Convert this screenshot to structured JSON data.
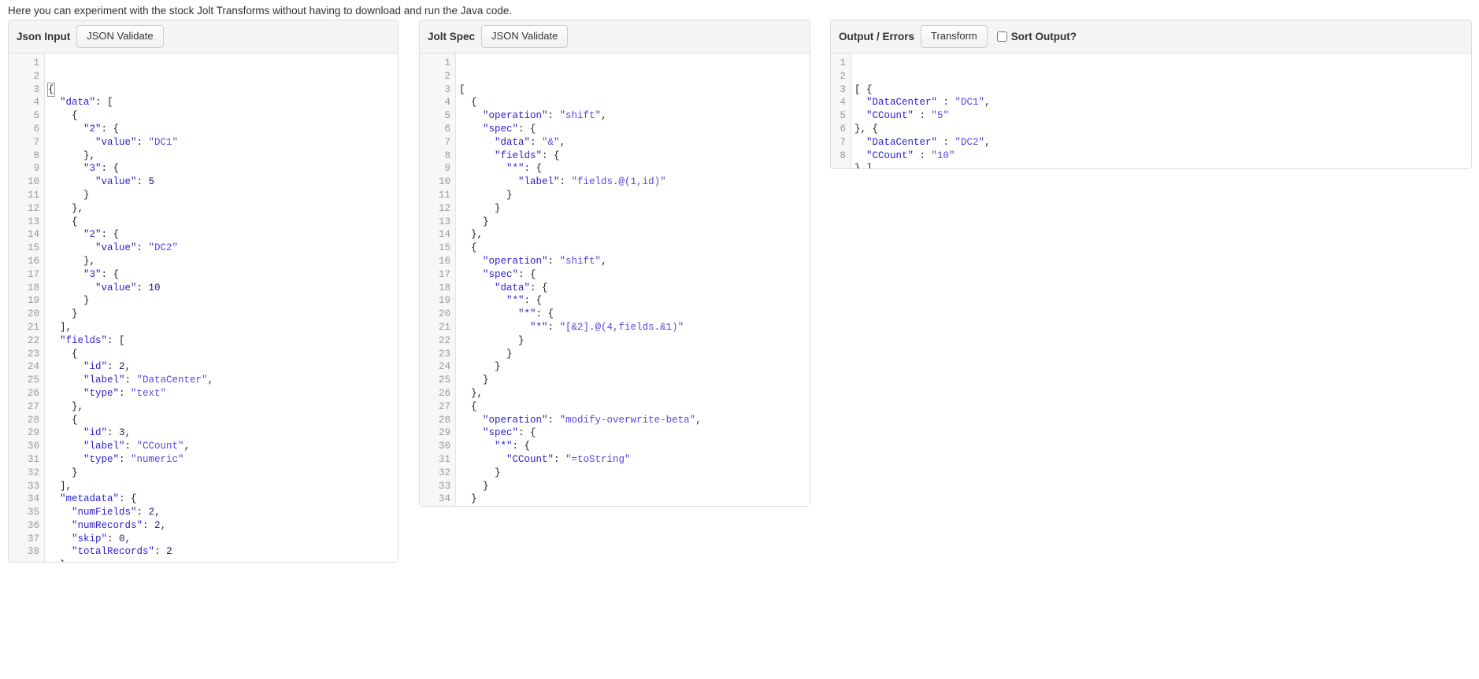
{
  "intro": {
    "text": "Here you can experiment with the stock Jolt Transforms without having to download and run the Java code."
  },
  "panels": {
    "input": {
      "title": "Json Input",
      "validate_button": "JSON Validate",
      "line_count": 38,
      "lines": [
        "{",
        "  \"data\": [",
        "    {",
        "      \"2\": {",
        "        \"value\": \"DC1\"",
        "      },",
        "      \"3\": {",
        "        \"value\": 5",
        "      }",
        "    },",
        "    {",
        "      \"2\": {",
        "        \"value\": \"DC2\"",
        "      },",
        "      \"3\": {",
        "        \"value\": 10",
        "      }",
        "    }",
        "  ],",
        "  \"fields\": [",
        "    {",
        "      \"id\": 2,",
        "      \"label\": \"DataCenter\",",
        "      \"type\": \"text\"",
        "    },",
        "    {",
        "      \"id\": 3,",
        "      \"label\": \"CCount\",",
        "      \"type\": \"numeric\"",
        "    }",
        "  ],",
        "  \"metadata\": {",
        "    \"numFields\": 2,",
        "    \"numRecords\": 2,",
        "    \"skip\": 0,",
        "    \"totalRecords\": 2",
        "  }",
        "}"
      ]
    },
    "spec": {
      "title": "Jolt Spec",
      "validate_button": "JSON Validate",
      "line_count": 34,
      "lines": [
        "[",
        "  {",
        "    \"operation\": \"shift\",",
        "    \"spec\": {",
        "      \"data\": \"&\",",
        "      \"fields\": {",
        "        \"*\": {",
        "          \"label\": \"fields.@(1,id)\"",
        "        }",
        "      }",
        "    }",
        "  },",
        "  {",
        "    \"operation\": \"shift\",",
        "    \"spec\": {",
        "      \"data\": {",
        "        \"*\": {",
        "          \"*\": {",
        "            \"*\": \"[&2].@(4,fields.&1)\"",
        "          }",
        "        }",
        "      }",
        "    }",
        "  },",
        "  {",
        "    \"operation\": \"modify-overwrite-beta\",",
        "    \"spec\": {",
        "      \"*\": {",
        "        \"CCount\": \"=toString\"",
        "      }",
        "    }",
        "  }",
        "]",
        ""
      ]
    },
    "output": {
      "title": "Output / Errors",
      "transform_button": "Transform",
      "sort_checkbox_label": "Sort Output?",
      "sort_checked": false,
      "line_count": 8,
      "lines": [
        "[ {",
        "  \"DataCenter\" : \"DC1\",",
        "  \"CCount\" : \"5\"",
        "}, {",
        "  \"DataCenter\" : \"DC2\",",
        "  \"CCount\" : \"10\"",
        "} ]",
        ""
      ]
    }
  },
  "colors": {
    "key": "#2b21c9",
    "string": "#5a45e0",
    "number": "#1a1a66",
    "punct": "#222222",
    "gutter_text": "#999999",
    "panel_border": "#dddddd",
    "header_bg": "#f5f5f5"
  }
}
